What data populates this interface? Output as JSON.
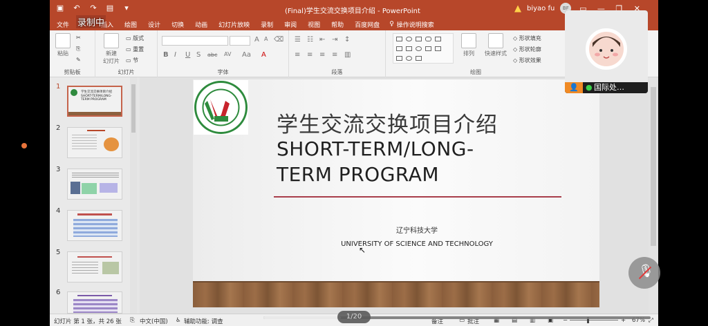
{
  "titlebar": {
    "title": "(Final)学生交流交换项目介绍 - PowerPoint",
    "user": "biyao fu",
    "user_initials": "BF",
    "qat_icons": [
      "save-icon",
      "undo-icon",
      "redo-icon",
      "present-icon"
    ]
  },
  "recording_label": "录制中",
  "menu": {
    "file": "文件",
    "tabs": [
      "插入",
      "绘图",
      "设计",
      "切换",
      "动画",
      "幻灯片放映",
      "录制",
      "审阅",
      "视图",
      "帮助",
      "百度网盘"
    ],
    "tell_me": "操作说明搜索"
  },
  "ribbon": {
    "clipboard": {
      "label": "剪贴板",
      "paste": "粘贴"
    },
    "slides": {
      "label": "幻灯片",
      "new_slide": "新建",
      "new_slide_2": "幻灯片",
      "layout": "版式",
      "reset": "重置",
      "section": "节"
    },
    "font": {
      "label": "字体",
      "bold": "B",
      "italic": "I",
      "underline": "U",
      "strike": "S",
      "shadow": "abc",
      "spacing": "AV",
      "grow": "A",
      "shrink": "A",
      "case": "Aa",
      "color": "A"
    },
    "paragraph": {
      "label": "段落"
    },
    "drawing": {
      "label": "绘图",
      "arrange": "排列",
      "quick_styles": "快速样式",
      "fill": "形状填充",
      "outline": "形状轮廓",
      "effects": "形状效果"
    }
  },
  "thumbnails": [
    {
      "num": "1",
      "title": "学生交流交换项目介绍",
      "subtitle": "SHORT-TERM/LONG-TERM PROGRAM"
    },
    {
      "num": "2"
    },
    {
      "num": "3"
    },
    {
      "num": "4"
    },
    {
      "num": "5"
    },
    {
      "num": "6"
    }
  ],
  "slide": {
    "cn_title": "学生交流交换项目介绍",
    "en_title": "SHORT-TERM/LONG-TERM PROGRAM",
    "cn_university": "辽宁科技大学",
    "en_university": "UNIVERSITY OF SCIENCE AND TECHNOLOGY",
    "logo_year": "1948",
    "logo_text": "UNIVERSITY OF SCIENCE AND TECHNOLOGY LIAONING"
  },
  "statusbar": {
    "slide_info": "幻灯片 第 1 张，共 26 张",
    "language": "中文(中国)",
    "accessibility": "辅助功能: 调查",
    "notes": "备注",
    "comments": "批注",
    "zoom": "67%"
  },
  "video": {
    "page": "1/20",
    "progress": 0.2
  },
  "participant": {
    "name": "国际处…"
  },
  "colors": {
    "accent": "#b7472a",
    "rule": "#a83d4a"
  }
}
